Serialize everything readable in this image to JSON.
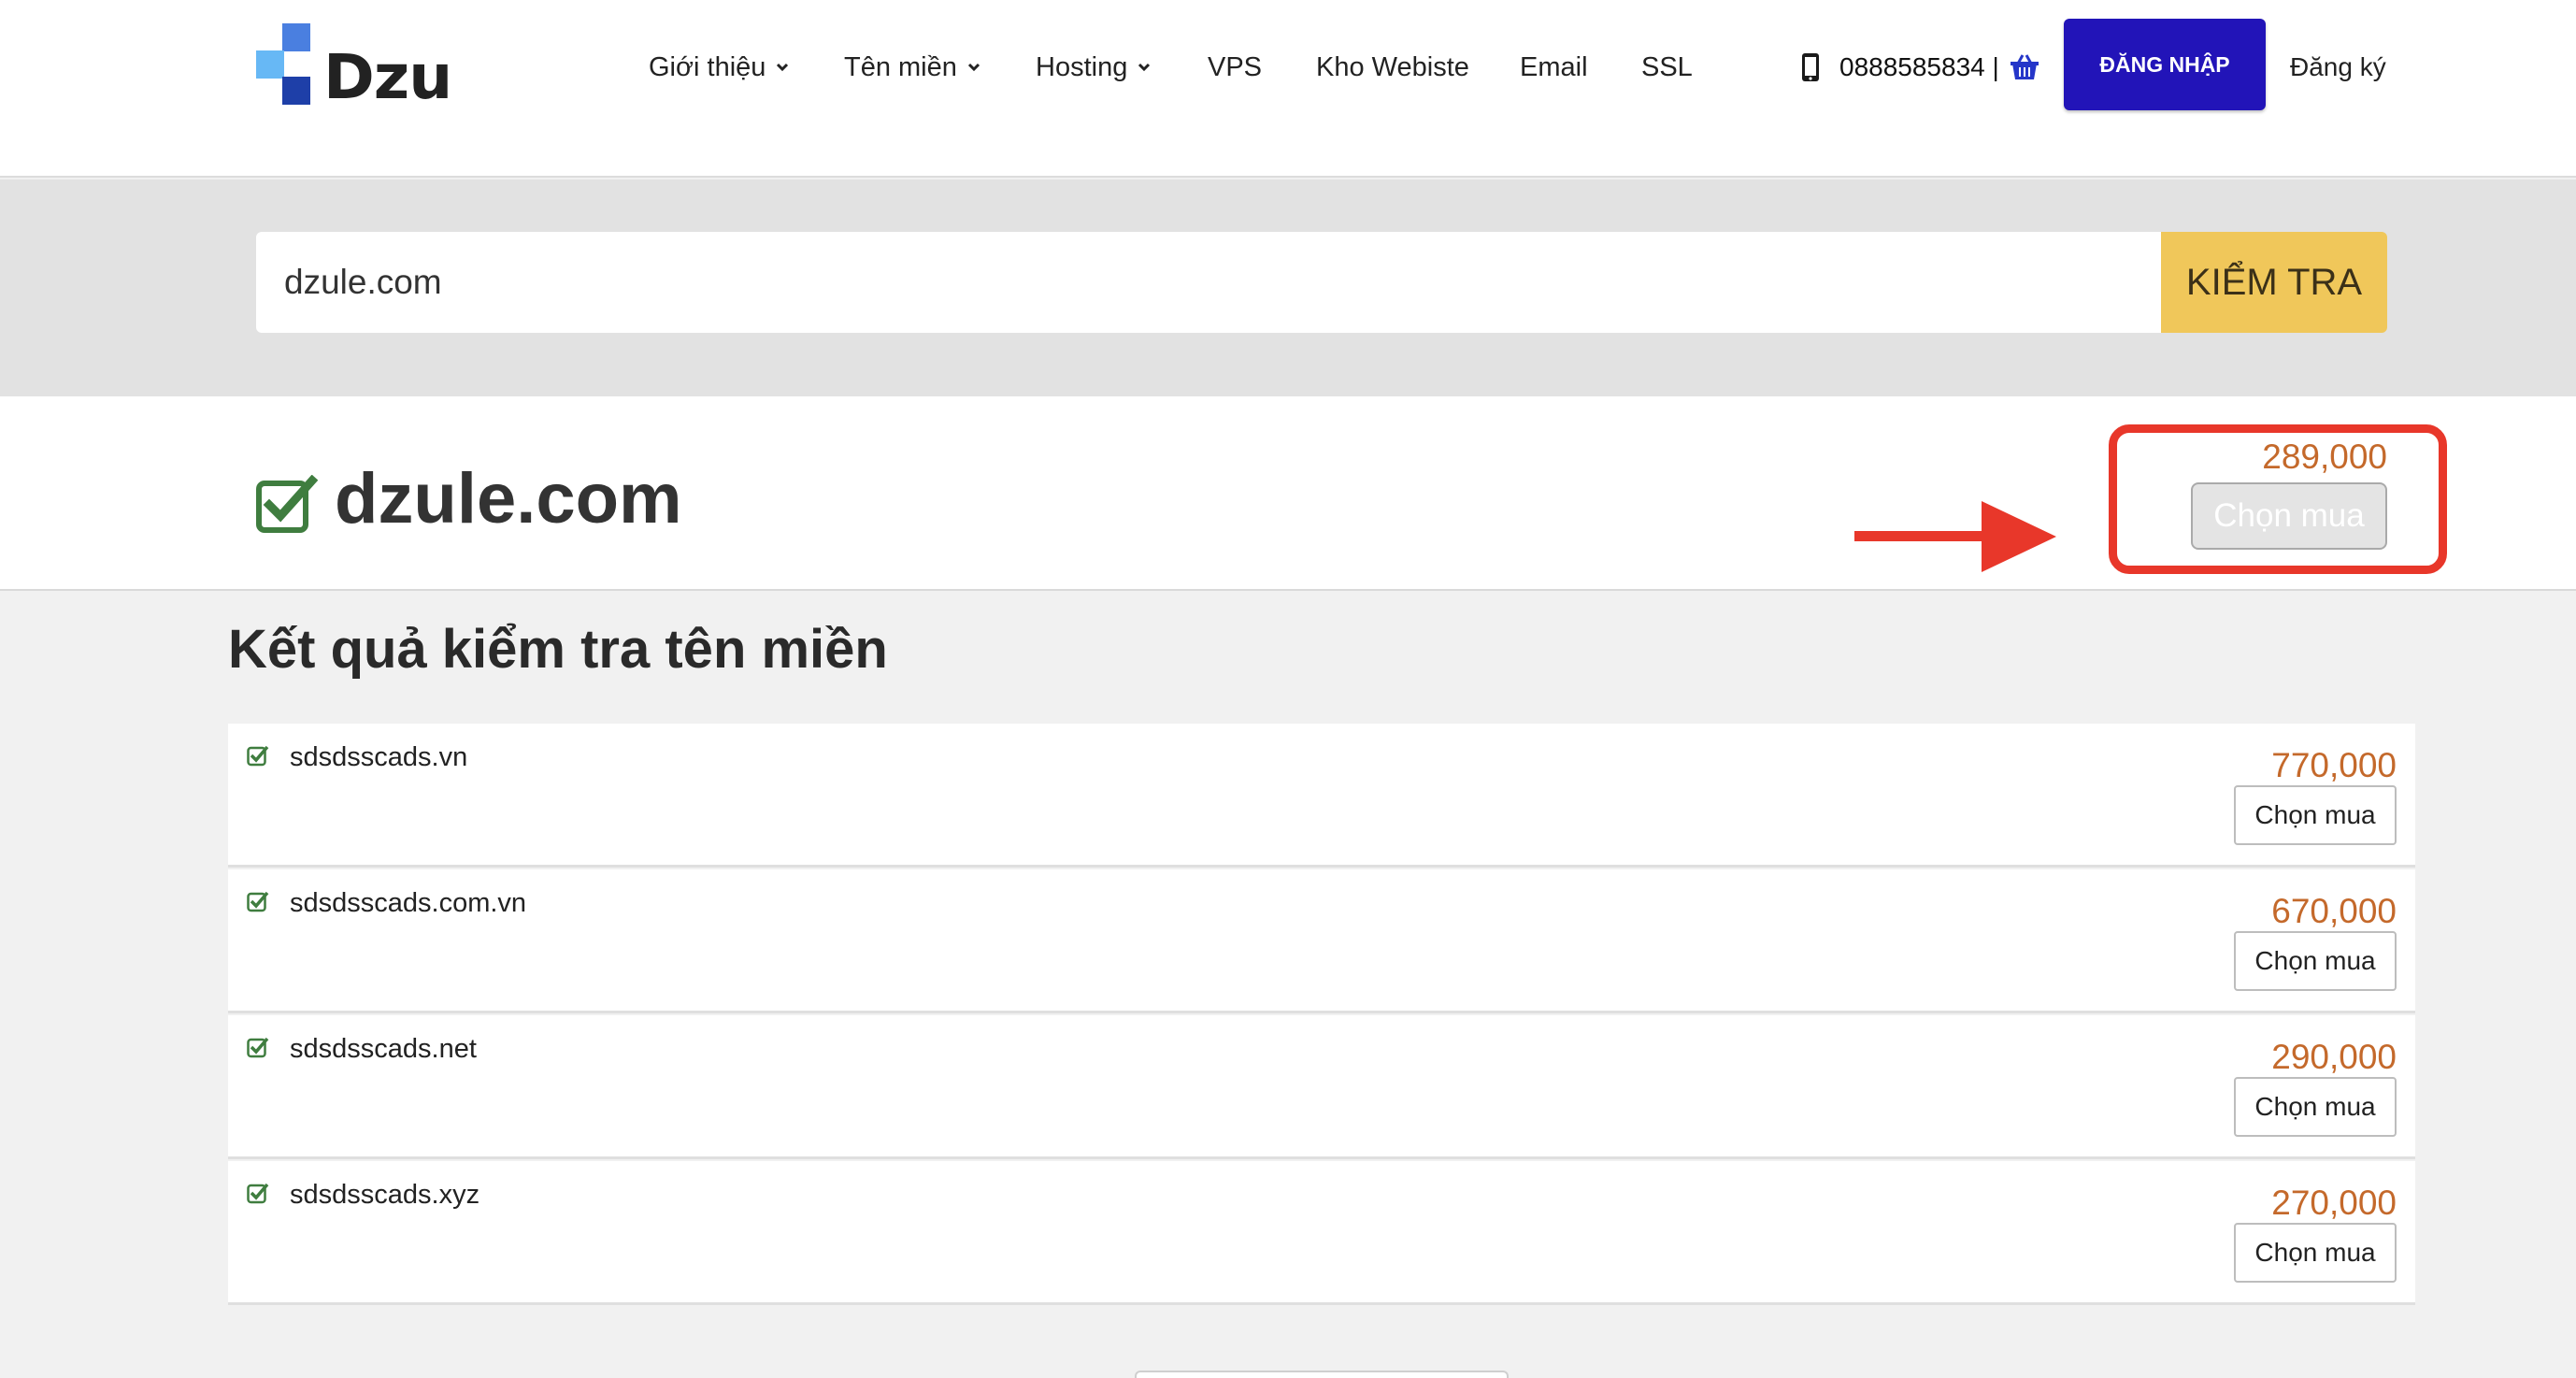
{
  "brand": {
    "name": "Dzu"
  },
  "nav": {
    "items": [
      {
        "label": "Giới thiệu",
        "dropdown": true
      },
      {
        "label": "Tên miền",
        "dropdown": true
      },
      {
        "label": "Hosting",
        "dropdown": true
      },
      {
        "label": "VPS",
        "dropdown": false
      },
      {
        "label": "Kho Webiste",
        "dropdown": false
      },
      {
        "label": "Email",
        "dropdown": false
      },
      {
        "label": "SSL",
        "dropdown": false
      }
    ],
    "phone": "0888585834 |",
    "login_label": "ĐĂNG NHẬP",
    "register_label": "Đăng ký"
  },
  "search": {
    "value": "dzule.com",
    "button_label": "KIỂM TRA"
  },
  "main_result": {
    "domain": "dzule.com",
    "price": "289,000",
    "buy_label": "Chọn mua"
  },
  "results": {
    "title": "Kết quả kiểm tra tên miền",
    "rows": [
      {
        "domain": "sdsdsscads.vn",
        "price": "770,000",
        "buy_label": "Chọn mua"
      },
      {
        "domain": "sdsdsscads.com.vn",
        "price": "670,000",
        "buy_label": "Chọn mua"
      },
      {
        "domain": "sdsdsscads.net",
        "price": "290,000",
        "buy_label": "Chọn mua"
      },
      {
        "domain": "sdsdsscads.xyz",
        "price": "270,000",
        "buy_label": "Chọn mua"
      }
    ]
  },
  "colors": {
    "accent": "#2214b8",
    "price": "#c4692b",
    "search_button": "#f0c75a",
    "highlight": "#e8372a",
    "check": "#3f8a3f"
  }
}
